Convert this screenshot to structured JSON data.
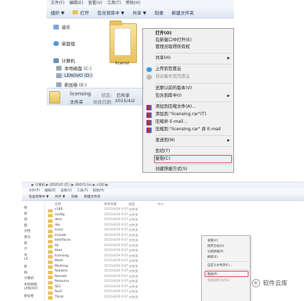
{
  "top": {
    "menubar": [
      "文件(F)",
      "编辑(E)",
      "查看(V)",
      "工具(T)",
      "帮助(H)"
    ],
    "toolbar": {
      "organize": "组织 ▼",
      "open": "打开",
      "include": "包含到库中 ▼",
      "share": "共享 ▼",
      "burn": "刻录",
      "new_folder": "新建文件夹"
    },
    "nav": {
      "music": "音乐",
      "homegroup": "家庭组",
      "computer": "计算机",
      "local_c": "本地磁盘 (C:)",
      "lenovo_d": "LENOVO (D:)",
      "new_e": "新加卷 (E:)"
    },
    "folder_name": "licensi",
    "details": {
      "name": "licensing",
      "type": "文件夹",
      "state_label": "状态:",
      "state_value": "已共享",
      "modified_label": "修改日期:",
      "modified_value": "2015/4/2"
    },
    "context_menu": {
      "open": "打开(O)",
      "open_new_window": "在新窗口中打开(E)",
      "take_ownership": "管理员取得所有权",
      "share": "共享(H)",
      "upload_cloud": "上传到百度云",
      "auto_backup": "自动备份到百度云",
      "restore_versions": "还原以前的版本(V)",
      "include_library": "包含到库中(I)",
      "add_archive": "添加到压缩文件(A)...",
      "add_rar": "添加到 \"licensing.rar\"(T)",
      "compress_email": "压缩并 E-mail...",
      "compress_rar_email": "压缩到 \"licensing.rar\" 并 E-mail",
      "send_to": "发送到(N)",
      "cut": "剪切(T)",
      "copy": "复制(C)",
      "create_shortcut": "创建快捷方式(S)"
    }
  },
  "bottom": {
    "address": "▶ 计算机 ▶ LENOVO (D:) ▶ ANSYS Inc ▶ v160 ▶",
    "menubar": [
      "文件(F)",
      "编辑(E)",
      "查看(V)",
      "工具(T)",
      "帮助(H)"
    ],
    "toolbar": [
      "包含到库中 ▼",
      "共享 ▼",
      "刻录",
      "新建文件夹"
    ],
    "headers": {
      "name": "名称",
      "date": "修改日期",
      "type": "类型",
      "size": "大小"
    },
    "left_nav": [
      "收",
      "库",
      "视",
      "图",
      "文档",
      "音乐",
      "家",
      "计",
      "本",
      "LE",
      "新",
      "网",
      "计算机",
      "本地磁盘",
      "LENOVO",
      "新加卷"
    ],
    "rows": [
      {
        "name": "v160",
        "date": "2015/4/29 9:07",
        "type": "文件夹"
      },
      {
        "name": "config",
        "date": "2015/4/29 9:07",
        "type": "文件夹"
      },
      {
        "name": "docs",
        "date": "2015/4/29 9:07",
        "type": "文件夹"
      },
      {
        "name": "doc",
        "date": "2015/4/29 9:07",
        "type": "文件夹"
      },
      {
        "name": "Icons",
        "date": "2015/4/29 9:07",
        "type": "文件夹"
      },
      {
        "name": "include",
        "date": "2015/4/29 9:07",
        "type": "文件夹"
      },
      {
        "name": "Interfaces",
        "date": "2015/4/29 9:07",
        "type": "文件夹"
      },
      {
        "name": "lib",
        "date": "2015/4/29 9:07",
        "type": "文件夹"
      },
      {
        "name": "libex",
        "date": "2015/4/29 9:07",
        "type": "文件夹"
      },
      {
        "name": "licensing",
        "date": "2015/4/29 9:07",
        "type": "文件夹"
      },
      {
        "name": "Mesh",
        "date": "2015/4/29 9:07",
        "type": "文件夹"
      },
      {
        "name": "Meshing",
        "date": "2015/4/29 9:07",
        "type": "文件夹"
      },
      {
        "name": "Readme",
        "date": "2015/4/29 9:07",
        "type": "文件夹"
      },
      {
        "name": "Remote",
        "date": "2015/4/29 9:07",
        "type": "文件夹"
      },
      {
        "name": "Resource",
        "date": "2015/4/29 9:07",
        "type": "文件夹"
      },
      {
        "name": "SEC",
        "date": "2015/4/29 9:07",
        "type": "文件夹"
      },
      {
        "name": "SysC",
        "date": "2015/4/29 9:07",
        "type": "文件夹"
      },
      {
        "name": "TGrid",
        "date": "2015/4/29 9:07",
        "type": "文件夹"
      }
    ],
    "context_menu": [
      "查看(V)",
      "排序方式(O)",
      "分组依据(P)",
      "刷新(E)",
      "自定义文件夹(F)...",
      "粘贴(P)",
      "粘贴快捷方式(S)"
    ]
  },
  "watermark": "软件云库"
}
